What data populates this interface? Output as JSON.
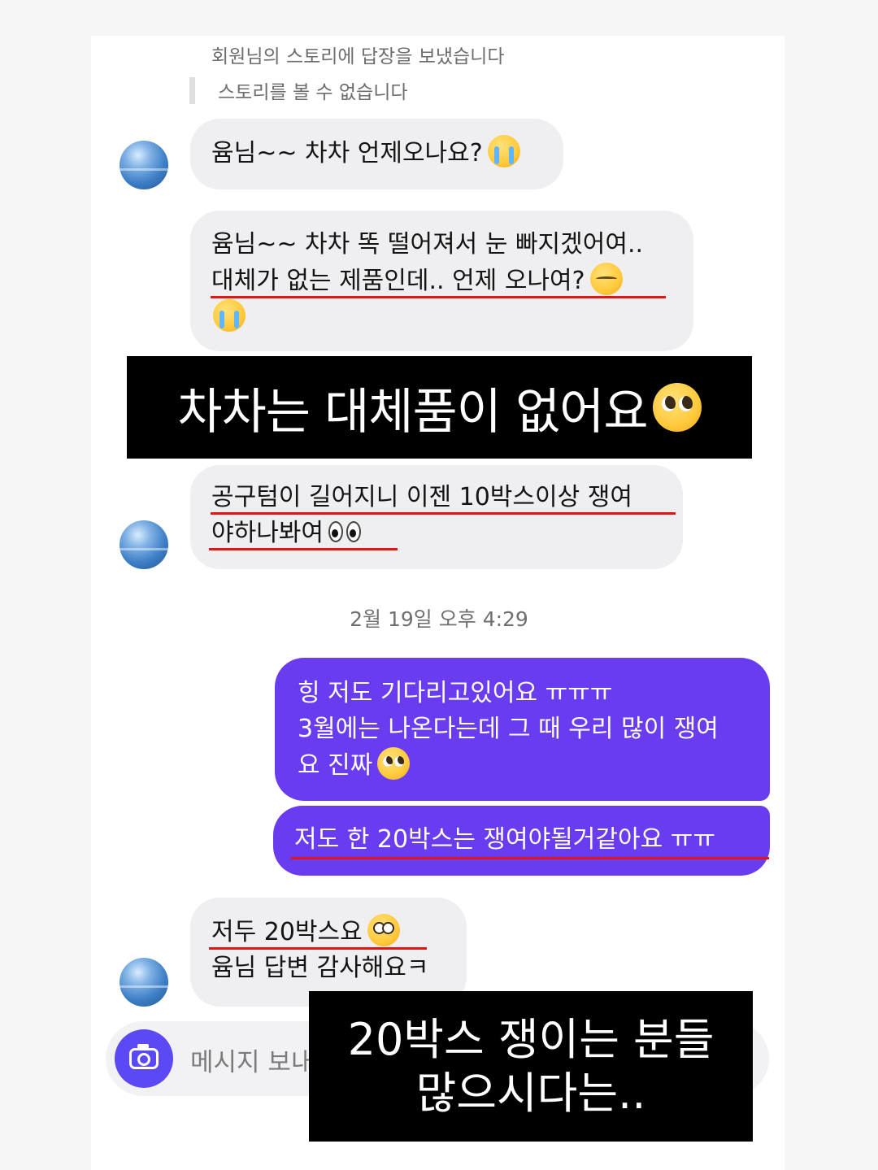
{
  "story_reply": {
    "notice": "회원님의 스토리에 답장을 보냈습니다",
    "unavailable": "스토리를 볼 수 없습니다"
  },
  "messages": {
    "in_1": {
      "line1": "윰님~~ 차차 언제오나요?",
      "emoji": "loudly-crying-face"
    },
    "in_2": {
      "line1": "윰님~~ 차차 똑 떨어져서 눈 빠지겠어여..",
      "line2": "대체가 없는 제품인데.. 언제 오나여?",
      "line2_emoji": "pensive-face",
      "line3_emoji": "loudly-crying-face"
    },
    "in_3": {
      "line1": "공구텀이 길어지니 이젠 10박스이상 쟁여",
      "line2": "야하나봐여",
      "emoji": "eyes"
    },
    "timestamp": "2월 19일 오후 4:29",
    "out_1": {
      "line1": "힝 저도 기다리고있어요 ㅠㅠㅠ",
      "line2": "3월에는 나온다는데 그 때 우리 많이 쟁여",
      "line3": "요 진짜",
      "emoji": "pleading-face"
    },
    "out_2": {
      "line1": "저도 한 20박스는 쟁여야될거같아요 ㅠㅠ"
    },
    "in_4": {
      "line1": "저두 20박스요",
      "emoji": "flushed-face",
      "line2": "윰님 답변 감사해요ㅋ"
    }
  },
  "captions": {
    "caption_1": "차차는 대체품이 없어요",
    "caption_1_emoji": "pleading-face",
    "caption_2_line1": "20박스 쟁이는 분들",
    "caption_2_line2": "많으시다는.."
  },
  "composer": {
    "placeholder": "메시지 보내기...",
    "camera_icon": "camera-icon"
  },
  "colors": {
    "outgoing_bubble": "#6a3cf0",
    "incoming_bubble": "#efeff1",
    "underline": "#e01515",
    "camera_button": "#5b49f3"
  }
}
